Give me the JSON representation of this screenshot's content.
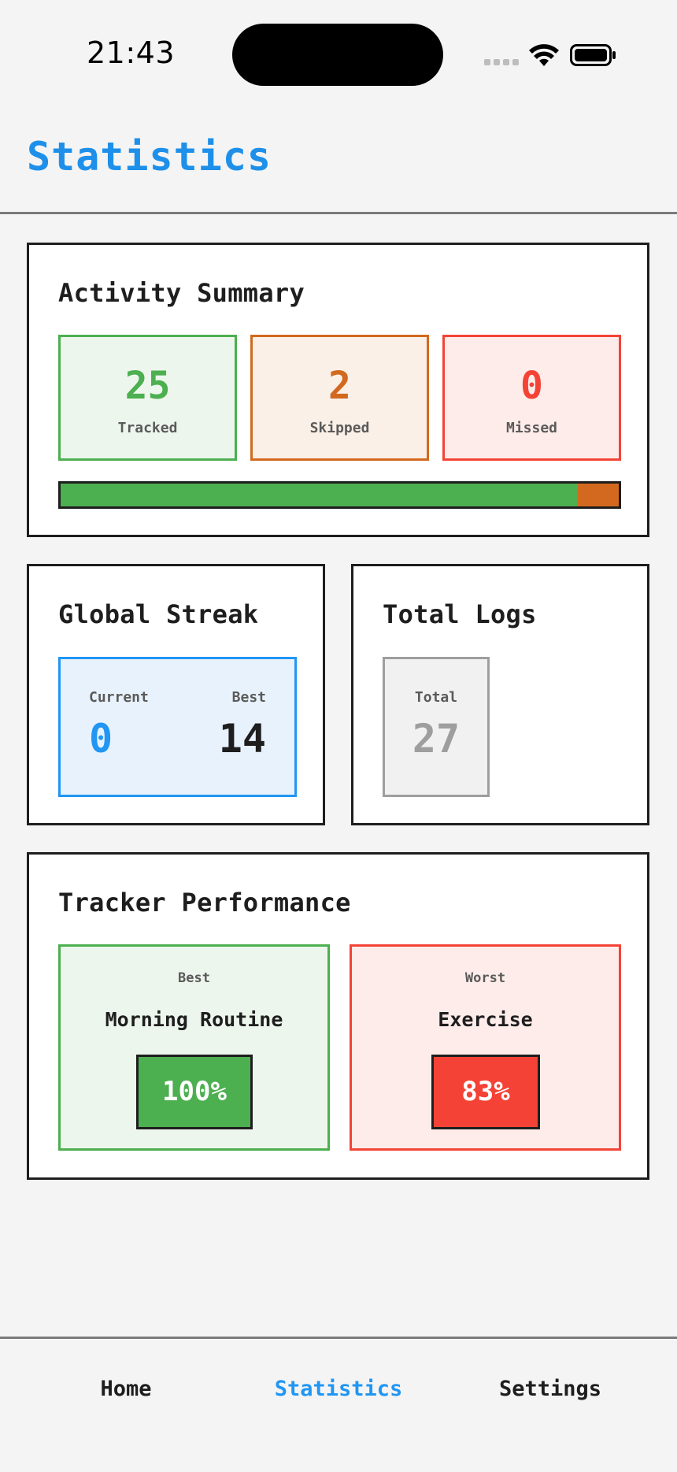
{
  "status_bar": {
    "time": "21:43",
    "icons": [
      "cellular-signal-icon",
      "wifi-icon",
      "battery-icon"
    ]
  },
  "header": {
    "title": "Statistics"
  },
  "activity_summary": {
    "title": "Activity Summary",
    "tracked": {
      "value": "25",
      "label": "Tracked"
    },
    "skipped": {
      "value": "2",
      "label": "Skipped"
    },
    "missed": {
      "value": "0",
      "label": "Missed"
    },
    "progress": {
      "tracked_fraction": 0.926,
      "skipped_fraction": 0.074,
      "missed_fraction": 0
    }
  },
  "global_streak": {
    "title": "Global Streak",
    "current_label": "Current",
    "current_value": "0",
    "best_label": "Best",
    "best_value": "14"
  },
  "total_logs": {
    "title": "Total Logs",
    "label": "Total",
    "value": "27"
  },
  "tracker_performance": {
    "title": "Tracker Performance",
    "best": {
      "label": "Best",
      "name": "Morning Routine",
      "percent": "100%"
    },
    "worst": {
      "label": "Worst",
      "name": "Exercise",
      "percent": "83%"
    }
  },
  "bottom_nav": {
    "items": [
      {
        "label": "Home",
        "active": false
      },
      {
        "label": "Statistics",
        "active": true
      },
      {
        "label": "Settings",
        "active": false
      }
    ]
  },
  "colors": {
    "accent": "#2196f3",
    "tracked": "#4caf50",
    "skipped": "#d2691e",
    "missed": "#f44336",
    "neutral": "#9e9e9e"
  }
}
